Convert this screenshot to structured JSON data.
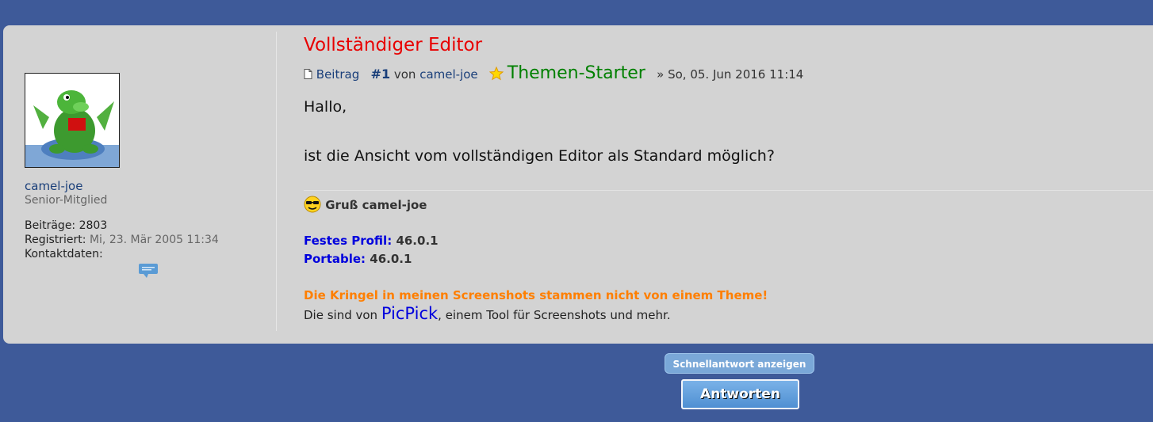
{
  "post": {
    "title": "Vollständiger Editor",
    "label_beitrag": "Beitrag",
    "number": "#1",
    "von": "von",
    "author_link": "camel-joe",
    "starter_label": "Themen-Starter",
    "date": "» So, 05. Jun 2016 11:14",
    "body_line1": "Hallo,",
    "body_line2": "ist die Ansicht vom vollständigen Editor als Standard möglich?"
  },
  "author": {
    "name": "camel-joe",
    "rank": "Senior-Mitglied",
    "posts_label": "Beiträge:",
    "posts_value": "2803",
    "registered_label": "Registriert:",
    "registered_value": "Mi, 23. Mär 2005 11:34",
    "contact_label": "Kontaktdaten:"
  },
  "signature": {
    "greeting": "Gruß camel-joe",
    "fixed_label": "Festes Profil:",
    "fixed_value": "46.0.1",
    "portable_label": "Portable:",
    "portable_value": "46.0.1",
    "notice": "Die Kringel in meinen Screenshots stammen nicht von einem Theme!",
    "line_prefix": "Die sind von",
    "picpick": "PicPick",
    "line_suffix": ", einem Tool für Screenshots und mehr."
  },
  "buttons": {
    "quick_reply": "Schnellantwort anzeigen",
    "reply": "Antworten"
  }
}
